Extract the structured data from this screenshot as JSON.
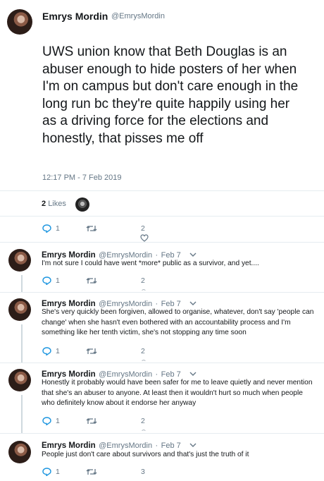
{
  "main_tweet": {
    "author_name": "Emrys Mordin",
    "handle": "@EmrysMordin",
    "text": "UWS union know that Beth Douglas is an abuser enough to hide posters of her when I'm on campus but don't care enough in the long run bc they're quite happily using her as a driving force for the elections and honestly, that pisses me off",
    "timestamp": "12:17 PM - 7 Feb 2019",
    "likes_count": "2",
    "likes_label": "Likes",
    "reply_count": "1",
    "retweet_count": "",
    "like_count": "2"
  },
  "replies": [
    {
      "author_name": "Emrys Mordin",
      "handle": "@EmrysMordin",
      "date": "Feb 7",
      "text": "I'm not sure I could have went *more* public as a survivor, and yet....",
      "reply_count": "1",
      "like_count": "2"
    },
    {
      "author_name": "Emrys Mordin",
      "handle": "@EmrysMordin",
      "date": "Feb 7",
      "text": "She's very quickly been forgiven, allowed to organise, whatever, don't say 'people can change' when she hasn't even bothered with an accountability process and I'm something like her tenth victim, she's not stopping any time soon",
      "reply_count": "1",
      "like_count": "2"
    },
    {
      "author_name": "Emrys Mordin",
      "handle": "@EmrysMordin",
      "date": "Feb 7",
      "text": "Honestly it probably would have been safer for me to leave quietly and never mention that she's an abuser to anyone. At least then it wouldn't hurt so much when people who definitely know about it endorse her anyway",
      "reply_count": "1",
      "like_count": "2"
    },
    {
      "author_name": "Emrys Mordin",
      "handle": "@EmrysMordin",
      "date": "Feb 7",
      "text": "People just don't care about survivors and that's just the truth of it",
      "reply_count": "1",
      "like_count": "3"
    }
  ],
  "icons": {
    "reply": "reply-icon",
    "retweet": "retweet-icon",
    "like": "heart-icon",
    "more": "chevron-down-icon"
  },
  "colors": {
    "text": "#14171a",
    "secondary": "#657786",
    "divider": "#e6ecf0",
    "thread_line": "#cfd9de"
  }
}
